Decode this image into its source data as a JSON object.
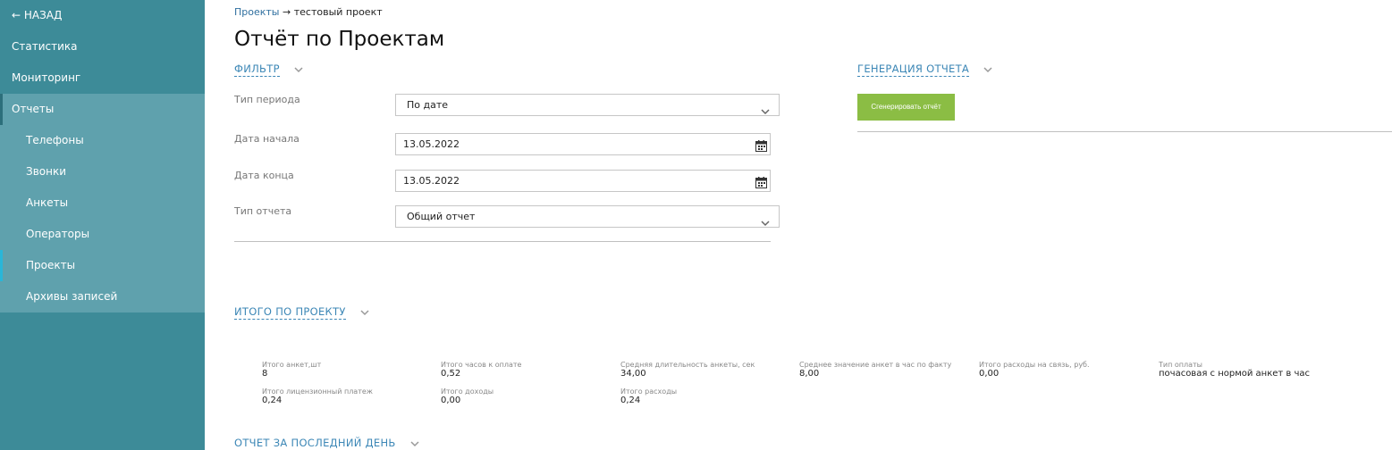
{
  "sidebar": {
    "back": "← НАЗАД",
    "items": [
      {
        "label": "Статистика"
      },
      {
        "label": "Мониторинг"
      },
      {
        "label": "Отчеты"
      }
    ],
    "sub_items": [
      {
        "label": "Телефоны"
      },
      {
        "label": "Звонки"
      },
      {
        "label": "Анкеты"
      },
      {
        "label": "Операторы"
      },
      {
        "label": "Проекты"
      },
      {
        "label": "Архивы записей"
      }
    ]
  },
  "breadcrumb": {
    "link": "Проекты",
    "sep": "→",
    "current": "тестовый проект"
  },
  "page_title": "Отчёт по Проектам",
  "filter": {
    "title": "ФИЛЬТР",
    "period_type_label": "Тип периода",
    "period_type_value": "По дате",
    "start_label": "Дата начала",
    "start_value": "13.05.2022",
    "end_label": "Дата конца",
    "end_value": "13.05.2022",
    "report_type_label": "Тип отчета",
    "report_type_value": "Общий отчет"
  },
  "generation": {
    "title": "ГЕНЕРАЦИЯ ОТЧЕТА",
    "button": "Сгенерировать отчёт"
  },
  "totals": {
    "title": "ИТОГО ПО ПРОЕКТУ",
    "stats": [
      {
        "label": "Итого анкет,шт",
        "value": "8"
      },
      {
        "label": "Итого часов к оплате",
        "value": "0,52"
      },
      {
        "label": "Средняя длительность анкеты, сек",
        "value": "34,00"
      },
      {
        "label": "Среднее значение анкет в час по факту",
        "value": "8,00"
      },
      {
        "label": "Итого расходы на связь, руб.",
        "value": "0,00"
      },
      {
        "label": "Тип оплаты",
        "value": "почасовая с нормой анкет в час"
      },
      {
        "label": "Итого лицензионный платеж",
        "value": "0,24"
      },
      {
        "label": "Итого доходы",
        "value": "0,00"
      },
      {
        "label": "Итого расходы",
        "value": "0,24"
      }
    ]
  },
  "last_day": {
    "title": "ОТЧЕТ ЗА ПОСЛЕДНИЙ ДЕНЬ"
  },
  "colors": {
    "sidebar": "#3d8b98",
    "sidebar_active": "#5fa1ad",
    "accent_link": "#3c87b6",
    "button": "#8bbd44"
  },
  "icons": [
    "chevron-down-icon",
    "calendar-icon"
  ]
}
